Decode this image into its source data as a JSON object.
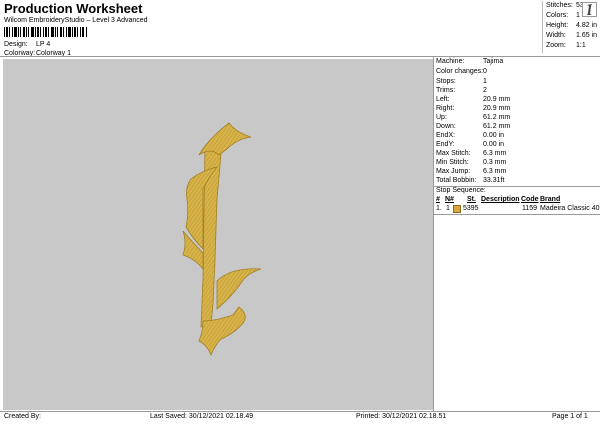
{
  "header": {
    "title": "Production Worksheet",
    "subtitle": "Wilcom EmbroideryStudio – Level 3 Advanced",
    "design_label": "Design:",
    "design_value": "LP 4",
    "colorway_label": "Colorway:",
    "colorway_value": "Colorway 1"
  },
  "summary": [
    {
      "label": "Stitches:",
      "value": "5397"
    },
    {
      "label": "Colors:",
      "value": "1"
    },
    {
      "label": "Height:",
      "value": "4.82 in"
    },
    {
      "label": "Width:",
      "value": "1.65 in"
    },
    {
      "label": "Zoom:",
      "value": "1:1"
    }
  ],
  "machine_info": [
    {
      "label": "Machine:",
      "value": "Tajima"
    },
    {
      "label": "Color changes:",
      "value": "0"
    },
    {
      "label": "Stops:",
      "value": "1"
    },
    {
      "label": "Trims:",
      "value": "2"
    },
    {
      "label": "Left:",
      "value": "20.9 mm"
    },
    {
      "label": "Right:",
      "value": "20.9 mm"
    },
    {
      "label": "Up:",
      "value": "61.2 mm"
    },
    {
      "label": "Down:",
      "value": "61.2 mm"
    },
    {
      "label": "EndX:",
      "value": "0.00 in"
    },
    {
      "label": "EndY:",
      "value": "0.00 in"
    },
    {
      "label": "Max Stitch:",
      "value": "6.3 mm"
    },
    {
      "label": "Min Stitch:",
      "value": "0.3 mm"
    },
    {
      "label": "Max Jump:",
      "value": "6.3 mm"
    },
    {
      "label": "Total Bobbin:",
      "value": "33.31ft"
    }
  ],
  "stop_sequence": {
    "heading": "Stop Sequence:",
    "columns": [
      "#",
      "N#",
      "St.",
      "Description",
      "Code",
      "Brand"
    ],
    "rows": [
      {
        "num": "1.",
        "n": "1",
        "st": "5395",
        "description": "",
        "code": "1159",
        "brand": "Madeira Classic 40"
      }
    ]
  },
  "footer": {
    "created_by": "Created By:",
    "last_saved": "Last Saved: 30/12/2021 02.18.49",
    "printed": "Printed: 30/12/2021 02.18.51",
    "page": "Page 1 of 1"
  },
  "colors": {
    "thread": "#d9a63f",
    "canvas": "#c8c8c8"
  },
  "icons": {
    "thumbnail": "design-thumbnail-icon"
  }
}
